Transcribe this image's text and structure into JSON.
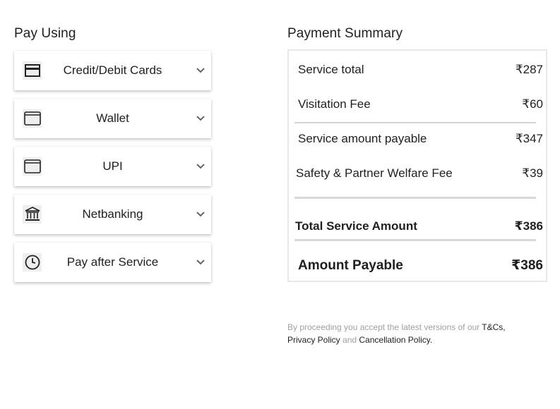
{
  "pay_using": {
    "title": "Pay Using",
    "options": [
      {
        "label": "Credit/Debit Cards",
        "icon": "card-icon"
      },
      {
        "label": "Wallet",
        "icon": "wallet-icon"
      },
      {
        "label": "UPI",
        "icon": "upi-icon"
      },
      {
        "label": "Netbanking",
        "icon": "bank-icon"
      },
      {
        "label": "Pay after Service",
        "icon": "clock-icon"
      }
    ]
  },
  "summary": {
    "title": "Payment Summary",
    "service_total_label": "Service total",
    "service_total_value": "₹287",
    "visitation_label": "Visitation Fee",
    "visitation_value": "₹60",
    "payable_label": "Service amount payable",
    "payable_value": "₹347",
    "safety_label": "Safety & Partner Welfare Fee",
    "safety_value": "₹39",
    "total_label": "Total Service Amount",
    "total_value": "₹386",
    "amount_label": "Amount Payable",
    "amount_value": "₹386"
  },
  "legal": {
    "prefix": "By proceeding you accept the latest versions of our ",
    "tnc": "T&Cs,",
    "privacy": "Privacy Policy",
    "and": " and ",
    "cancellation": "Cancellation Policy."
  }
}
